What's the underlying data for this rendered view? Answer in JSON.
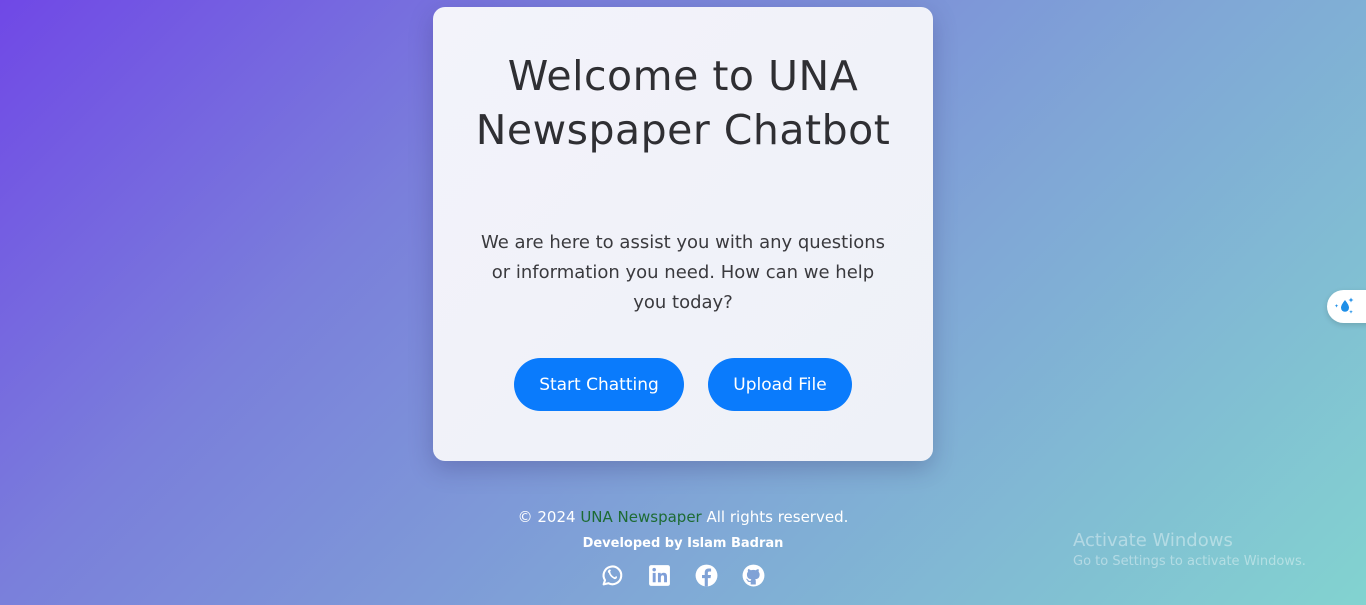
{
  "hero": {
    "title": "Welcome to UNA Newspaper Chatbot",
    "subtitle": "We are here to assist you with any questions or information you need. How can we help you today?",
    "start_button_label": "Start Chatting",
    "upload_button_label": "Upload File"
  },
  "footer": {
    "copyright_prefix": "© 2024 ",
    "brand_name": "UNA Newspaper",
    "copyright_suffix": " All rights reserved.",
    "credit": "Developed by Islam Badran",
    "socials": [
      "whatsapp-icon",
      "linkedin-icon",
      "facebook-icon",
      "github-icon"
    ]
  },
  "watermark": {
    "title": "Activate Windows",
    "subtitle": "Go to Settings to activate Windows."
  },
  "colors": {
    "accent_button": "#0a7bfc",
    "brand_link": "#1d6b33",
    "background_start": "#7048e6",
    "background_end": "#82d3d0"
  }
}
